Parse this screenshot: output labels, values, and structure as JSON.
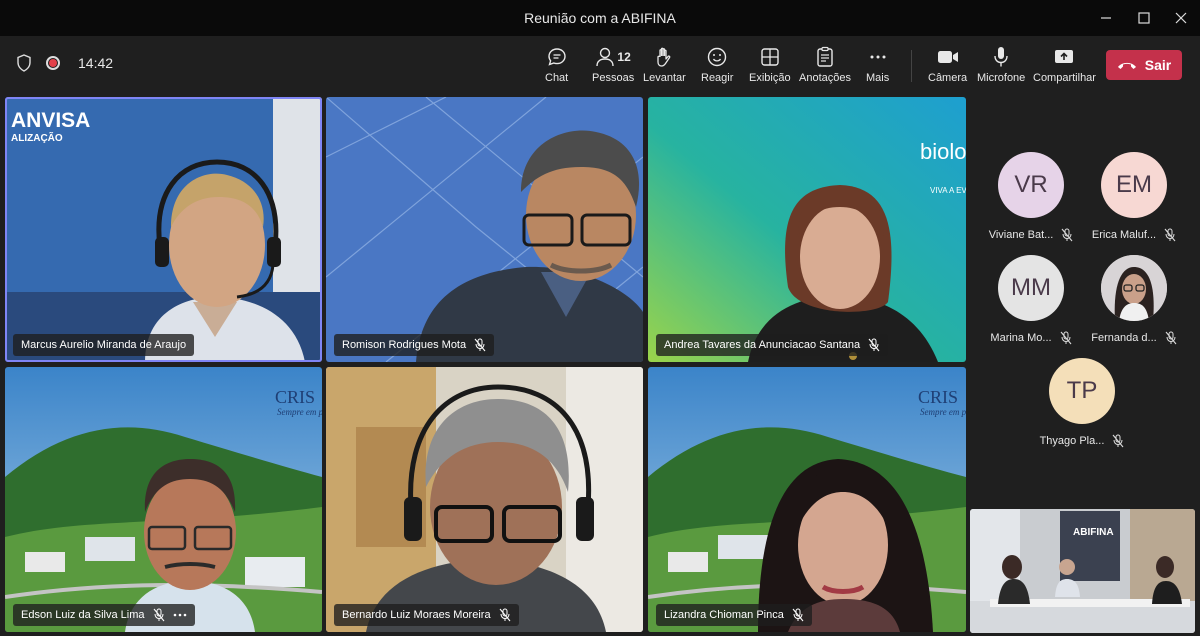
{
  "window": {
    "title": "Reunião com a ABIFINA"
  },
  "toolbar": {
    "timer": "14:42",
    "people_count": "12",
    "buttons": {
      "chat": "Chat",
      "people": "Pessoas",
      "raise": "Levantar",
      "react": "Reagir",
      "view": "Exibição",
      "notes": "Anotações",
      "more": "Mais",
      "camera": "Câmera",
      "mic": "Microfone",
      "share": "Compartilhar"
    },
    "leave": "Sair"
  },
  "tiles": [
    {
      "name": "Marcus Aurelio Miranda de Araujo",
      "muted": false,
      "bg_text": "ANVISA",
      "bg_sub": "ALIZAÇÃO"
    },
    {
      "name": "Romison Rodrigues Mota",
      "muted": true
    },
    {
      "name": "Andrea Tavares da Anunciacao Santana",
      "muted": true,
      "bg_text": "biolo",
      "bg_sub": "VIVA A EVOLUÇÃ"
    },
    {
      "name": "Edson Luiz da Silva Lima",
      "muted": true,
      "bg_text": "CRIS",
      "bg_sub": "Sempre em p"
    },
    {
      "name": "Bernardo Luiz Moraes Moreira",
      "muted": true
    },
    {
      "name": "Lizandra Chioman Pinca",
      "muted": true,
      "bg_text": "CRIS",
      "bg_sub": "Sempre em p"
    }
  ],
  "participants": [
    {
      "initials": "VR",
      "name": "Viviane Bat...",
      "color": "#e6d3e8"
    },
    {
      "initials": "EM",
      "name": "Erica Maluf...",
      "color": "#f7d8d3"
    },
    {
      "initials": "MM",
      "name": "Marina Mo...",
      "color": "#e4e4e4"
    },
    {
      "initials": "",
      "name": "Fernanda d...",
      "color": "#c9c0c0"
    },
    {
      "initials": "TP",
      "name": "Thyago Pla...",
      "color": "#f4dfb9"
    }
  ],
  "room_view": {
    "sign": "ABIFINA"
  }
}
